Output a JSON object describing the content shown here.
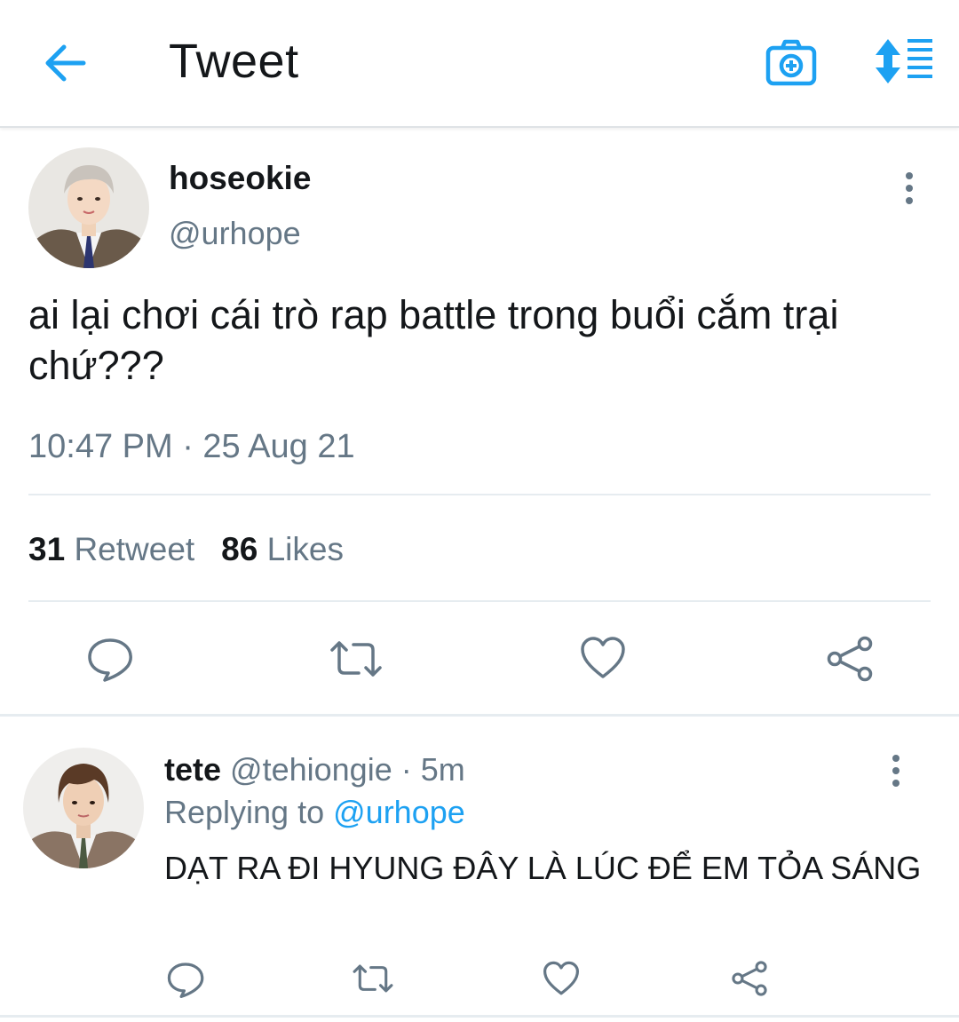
{
  "header": {
    "title": "Tweet",
    "icons": {
      "back": "arrow-left-icon",
      "camera": "camera-plus-icon",
      "sort": "sort-list-icon"
    },
    "accent_color": "#1da1f2"
  },
  "tweet": {
    "author_name": "hoseokie",
    "author_handle": "@urhope",
    "text": "ai lại chơi cái trò rap battle trong buổi cắm trại chứ???",
    "timestamp": "10:47 PM · 25 Aug 21",
    "stats": {
      "retweets_count": "31",
      "retweets_label": "Retweet",
      "likes_count": "86",
      "likes_label": "Likes"
    },
    "actions": [
      "reply-icon",
      "retweet-icon",
      "heart-icon",
      "share-icon"
    ]
  },
  "reply": {
    "author_name": "tete",
    "author_handle": "@tehiongie",
    "separator": "·",
    "time": "5m",
    "replying_label": "Replying to",
    "replying_to": "@urhope",
    "text": "DẠT RA ĐI HYUNG ĐÂY LÀ LÚC ĐỂ EM TỎA SÁNG",
    "actions": [
      "reply-icon",
      "retweet-icon",
      "heart-icon",
      "share-icon"
    ]
  },
  "colors": {
    "text_primary": "#14171a",
    "text_secondary": "#657786",
    "link": "#1da1f2",
    "divider": "#e6ecf0"
  }
}
